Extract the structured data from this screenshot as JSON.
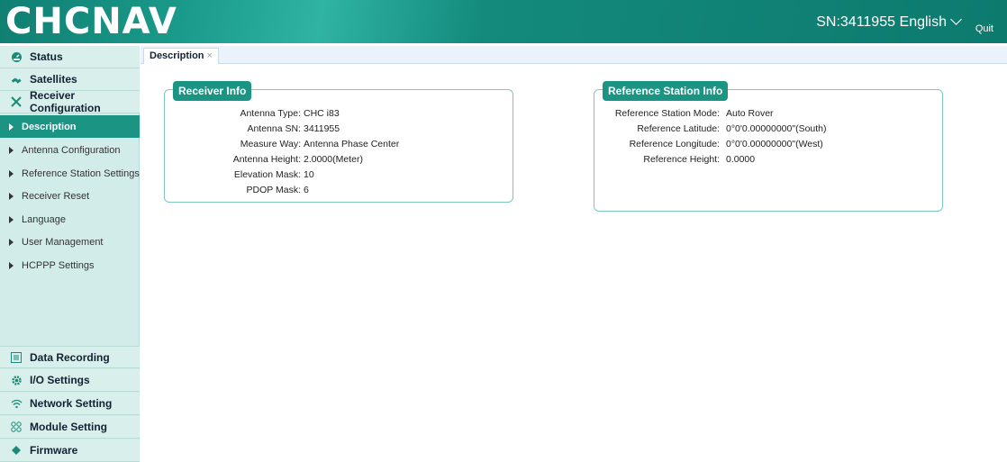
{
  "header": {
    "logo": "CHCNAV",
    "serial": "SN:3411955",
    "language": "English",
    "quit": "Quit"
  },
  "sidebar": {
    "items_top": [
      {
        "label": "Status",
        "icon": "gauge-icon"
      },
      {
        "label": "Satellites",
        "icon": "satellite-icon"
      },
      {
        "label": "Receiver Configuration",
        "icon": "tools-icon"
      }
    ],
    "sub_items": [
      {
        "label": "Description",
        "active": true
      },
      {
        "label": "Antenna Configuration"
      },
      {
        "label": "Reference Station Settings"
      },
      {
        "label": "Receiver Reset"
      },
      {
        "label": "Language"
      },
      {
        "label": "User Management"
      },
      {
        "label": "HCPPP Settings"
      }
    ],
    "items_bottom": [
      {
        "label": "Data Recording",
        "icon": "list-icon"
      },
      {
        "label": "I/O Settings",
        "icon": "gear-icon"
      },
      {
        "label": "Network Setting",
        "icon": "wifi-icon"
      },
      {
        "label": "Module Setting",
        "icon": "modules-icon"
      },
      {
        "label": "Firmware",
        "icon": "chip-icon"
      }
    ]
  },
  "tabs": [
    {
      "label": "Description",
      "close": "×"
    }
  ],
  "receiver_info": {
    "title": "Receiver Info",
    "rows": [
      {
        "key": "Antenna Type:",
        "value": "CHC i83"
      },
      {
        "key": "Antenna SN:",
        "value": "3411955"
      },
      {
        "key": "Measure Way:",
        "value": "Antenna Phase Center"
      },
      {
        "key": "Antenna Height:",
        "value": "2.0000(Meter)"
      },
      {
        "key": "Elevation Mask:",
        "value": "10"
      },
      {
        "key": "PDOP Mask:",
        "value": "6"
      }
    ]
  },
  "reference_info": {
    "title": "Reference Station Info",
    "rows": [
      {
        "key": "Reference Station Mode:",
        "value": "Auto Rover"
      },
      {
        "key": "Reference Latitude:",
        "value": "0°0'0.00000000\"(South)"
      },
      {
        "key": "Reference Longitude:",
        "value": "0°0'0.00000000\"(West)"
      },
      {
        "key": "Reference Height:",
        "value": "0.0000"
      }
    ]
  }
}
